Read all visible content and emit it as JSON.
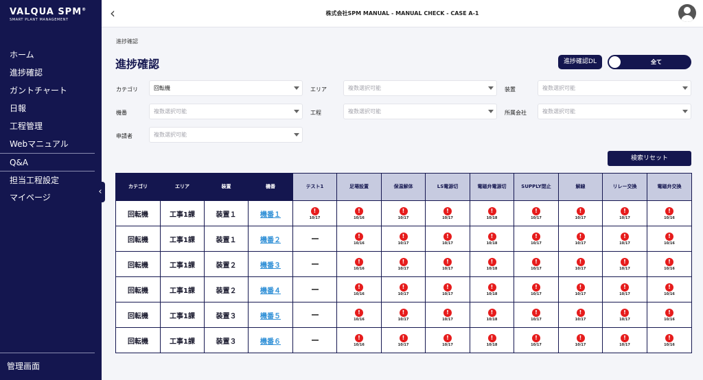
{
  "brand": {
    "name": "VALQUA SPM",
    "reg": "®",
    "tagline": "SMART PLANT MANAGEMENT"
  },
  "sidebar": {
    "items": [
      {
        "label": "ホーム"
      },
      {
        "label": "進捗確認"
      },
      {
        "label": "ガントチャート"
      },
      {
        "label": "日報"
      },
      {
        "label": "工程管理"
      },
      {
        "label": "Webマニュアル"
      },
      {
        "label": "Q&A"
      },
      {
        "label": "担当工程設定"
      },
      {
        "label": "マイページ"
      }
    ],
    "bottom": "管理画面",
    "collapse_icon": "‹"
  },
  "header": {
    "title": "株式会社SPM MANUAL - MANUAL CHECK - CASE A-1",
    "back_icon": "‹"
  },
  "page": {
    "breadcrumb": "進捗確認",
    "title": "進捗確認",
    "download_label": "進捗確認DL",
    "toggle_label": "全て",
    "reset_label": "検索リセット"
  },
  "filters": {
    "category": {
      "label": "カテゴリ",
      "value": "回転機"
    },
    "area": {
      "label": "エリア",
      "placeholder": "複数選択可能"
    },
    "device": {
      "label": "装置",
      "placeholder": "複数選択可能"
    },
    "machine": {
      "label": "機番",
      "placeholder": "複数選択可能"
    },
    "process": {
      "label": "工程",
      "placeholder": "複数選択可能"
    },
    "company": {
      "label": "所属会社",
      "placeholder": "複数選択可能"
    },
    "applicant": {
      "label": "申請者",
      "placeholder": "複数選択可能"
    }
  },
  "table": {
    "columns": [
      "カテゴリ",
      "エリア",
      "装置",
      "機番",
      "テスト1",
      "足場設置",
      "保温解体",
      "LS電源切",
      "電磁弁電源切",
      "SUPPLY閉止",
      "解線",
      "リレー交換",
      "電磁弁交換"
    ],
    "alert_glyph": "!",
    "rows": [
      {
        "category": "回転機",
        "area": "工事1課",
        "device": "装置１",
        "machine": "機番１",
        "test1": "!",
        "test1_date": "10/17",
        "dates": [
          "10/16",
          "10/17",
          "10/17",
          "10/18",
          "10/17",
          "10/17",
          "10/17",
          "10/16"
        ]
      },
      {
        "category": "回転機",
        "area": "工事1課",
        "device": "装置１",
        "machine": "機番２",
        "test1": "",
        "test1_date": "",
        "dates": [
          "10/16",
          "10/17",
          "10/17",
          "10/18",
          "10/17",
          "10/17",
          "10/17",
          "10/16"
        ]
      },
      {
        "category": "回転機",
        "area": "工事1課",
        "device": "装置２",
        "machine": "機番３",
        "test1": "",
        "test1_date": "",
        "dates": [
          "10/16",
          "10/17",
          "10/17",
          "10/18",
          "10/17",
          "10/17",
          "10/17",
          "10/16"
        ]
      },
      {
        "category": "回転機",
        "area": "工事1課",
        "device": "装置２",
        "machine": "機番４",
        "test1": "",
        "test1_date": "",
        "dates": [
          "10/16",
          "10/17",
          "10/17",
          "10/18",
          "10/17",
          "10/17",
          "10/17",
          "10/16"
        ]
      },
      {
        "category": "回転機",
        "area": "工事1課",
        "device": "装置３",
        "machine": "機番５",
        "test1": "",
        "test1_date": "",
        "dates": [
          "10/16",
          "10/17",
          "10/17",
          "10/18",
          "10/17",
          "10/17",
          "10/17",
          "10/16"
        ]
      },
      {
        "category": "回転機",
        "area": "工事1課",
        "device": "装置３",
        "machine": "機番６",
        "test1": "",
        "test1_date": "",
        "dates": [
          "10/16",
          "10/17",
          "10/17",
          "10/18",
          "10/17",
          "10/17",
          "10/17",
          "10/16"
        ]
      }
    ]
  },
  "colors": {
    "navy": "#14164f",
    "header_light": "#c7cbe0",
    "alert": "#e61c1c",
    "link": "#2f8fd6"
  },
  "icons": {
    "back": "chevron-left-icon",
    "user": "user-avatar-icon",
    "alert": "alert-circle-icon",
    "dropdown": "caret-down-icon"
  }
}
